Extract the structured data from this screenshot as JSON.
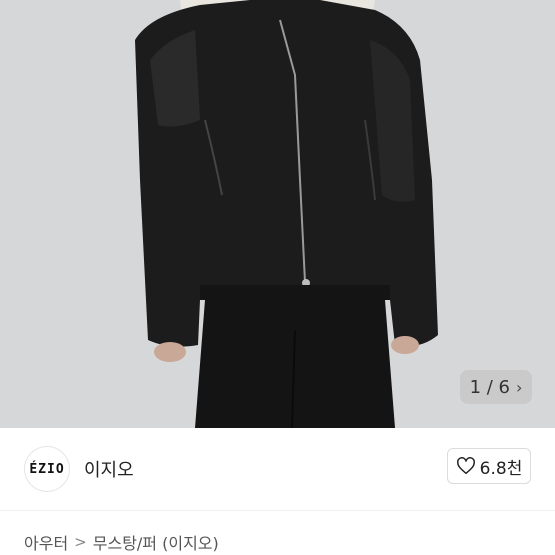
{
  "carousel": {
    "counter": "1 / 6",
    "next_icon": "chevron-right-icon"
  },
  "brand": {
    "logo_text": "ÉZIO",
    "name": "이지오"
  },
  "like": {
    "icon": "heart-outline-icon",
    "count": "6.8천"
  },
  "breadcrumb": {
    "parent": "아우터",
    "separator": ">",
    "current": "무스탕/퍼 (이지오)"
  }
}
